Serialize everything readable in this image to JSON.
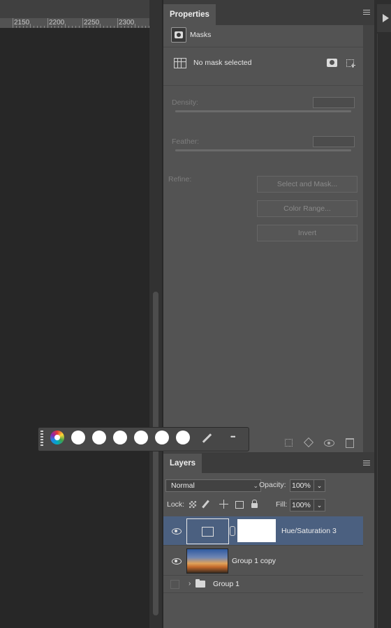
{
  "ruler": {
    "ticks": [
      "2150",
      "2200",
      "2250",
      "2300"
    ]
  },
  "properties": {
    "tab_label": "Properties",
    "section_label": "Masks",
    "mask_status": "No mask selected",
    "density_label": "Density:",
    "feather_label": "Feather:",
    "refine_label": "Refine:",
    "buttons": {
      "select_and_mask": "Select and Mask...",
      "color_range": "Color Range...",
      "invert": "Invert"
    }
  },
  "color_toolbar": {
    "icons": [
      "color-wheel-icon",
      "eyedropper-icon",
      "more-icon"
    ],
    "more_label": "•••"
  },
  "layers": {
    "tab_label": "Layers",
    "blend_mode": "Normal",
    "opacity_label": "Opacity:",
    "opacity_value": "100%",
    "lock_label": "Lock:",
    "fill_label": "Fill:",
    "fill_value": "100%",
    "items": [
      {
        "name": "Hue/Saturation 3",
        "visible": true,
        "selected": true
      },
      {
        "name": "Group 1 copy",
        "visible": true,
        "selected": false
      },
      {
        "name": "Group 1",
        "visible": false,
        "selected": false
      }
    ]
  },
  "colors": {
    "panel_bg": "#535353",
    "selected_layer": "#4b6080",
    "canvas_bg": "#272727"
  }
}
